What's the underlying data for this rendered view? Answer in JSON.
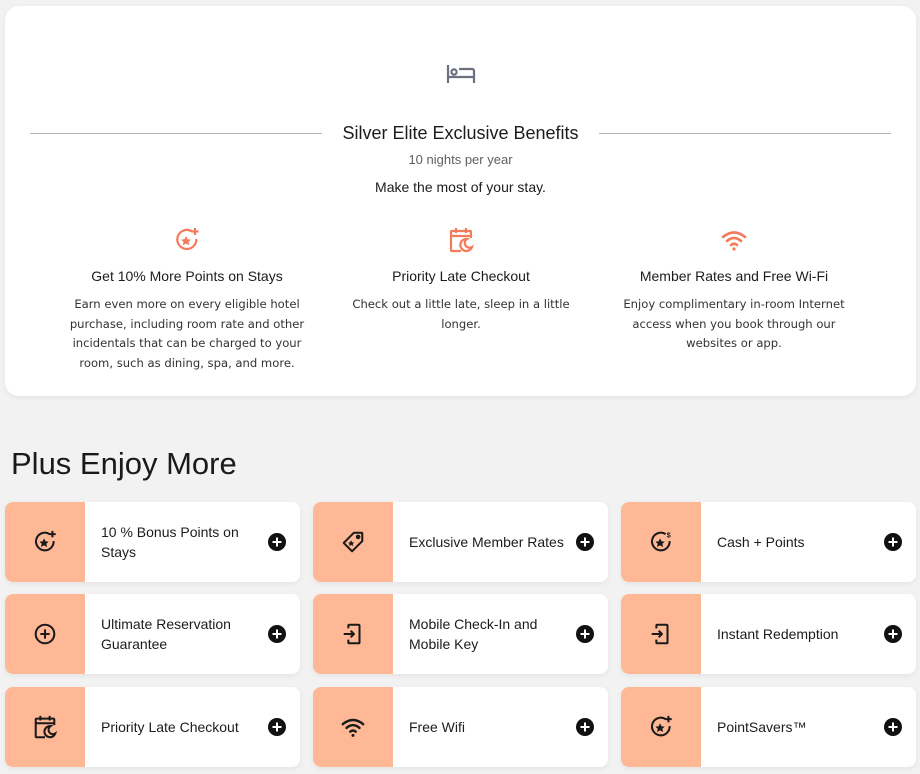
{
  "tier_card": {
    "header_icon": "bed-icon",
    "title": "Silver Elite Exclusive Benefits",
    "subtitle": "10 nights per year",
    "tagline": "Make the most of your stay.",
    "accent_color": "#f47b5a",
    "features": [
      {
        "icon": "star-plus-icon",
        "heading": "Get 10% More Points on Stays",
        "description": "Earn even more on every eligible hotel purchase, including room rate and other incidentals that can be charged to your room, such as dining, spa, and more."
      },
      {
        "icon": "calendar-moon-icon",
        "heading": "Priority Late Checkout",
        "description": "Check out a little late, sleep in a little longer."
      },
      {
        "icon": "wifi-icon",
        "heading": "Member Rates and Free Wi-Fi",
        "description": "Enjoy complimentary in-room Internet access when you book through our websites or app."
      }
    ]
  },
  "more_section": {
    "title": "Plus Enjoy More",
    "tile_color": "#ffb896",
    "items": [
      {
        "icon": "star-plus-icon",
        "label": "10 % Bonus Points on Stays"
      },
      {
        "icon": "tag-icon",
        "label": "Exclusive Member Rates"
      },
      {
        "icon": "star-dollar-icon",
        "label": "Cash + Points"
      },
      {
        "icon": "circle-plus-icon",
        "label": "Ultimate Reservation Guarantee"
      },
      {
        "icon": "mobile-checkin-icon",
        "label": "Mobile Check-In and Mobile Key"
      },
      {
        "icon": "mobile-checkin-icon",
        "label": "Instant Redemption"
      },
      {
        "icon": "calendar-moon-icon",
        "label": "Priority Late Checkout"
      },
      {
        "icon": "wifi-icon",
        "label": "Free Wifi"
      },
      {
        "icon": "star-plus-icon",
        "label": "PointSavers™"
      }
    ]
  }
}
